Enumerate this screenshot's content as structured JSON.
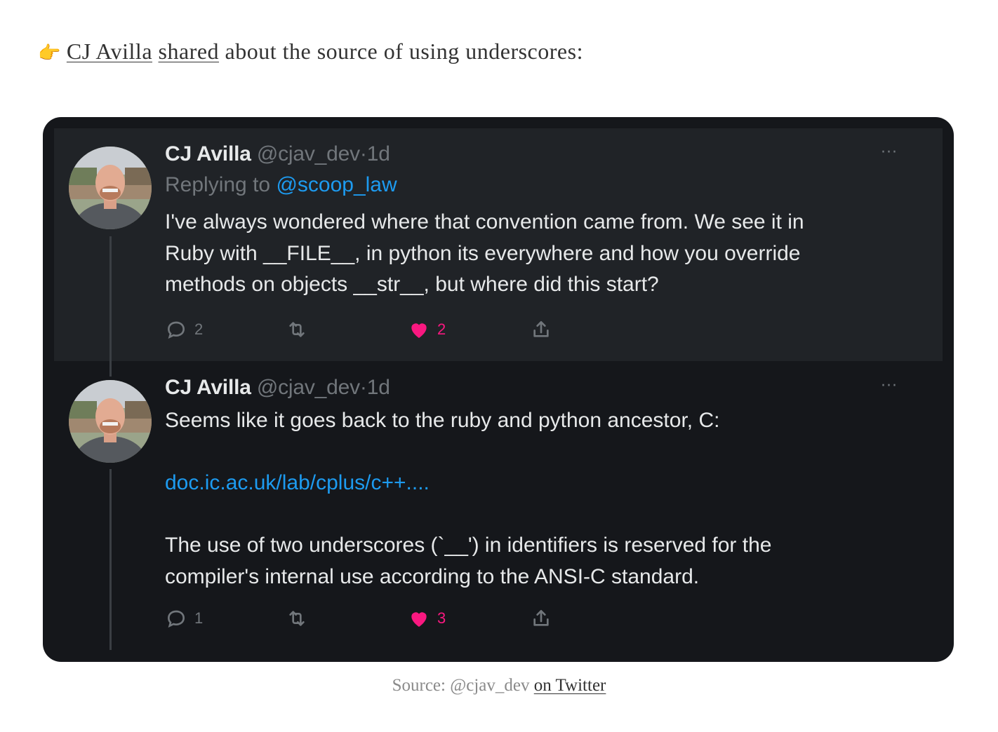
{
  "intro": {
    "emoji": "👉",
    "author_link": "CJ Avilla",
    "shared_link": "shared",
    "rest": " about the source of using underscores:"
  },
  "tweets": [
    {
      "name": "CJ Avilla",
      "handle": "@cjav_dev",
      "sep": "·",
      "time": "1d",
      "replying_prefix": "Replying to ",
      "replying_to": "@scoop_law",
      "lines": [
        "I've always wondered where that convention came from. We see it in",
        "Ruby with __FILE__, in python its everywhere and how you override",
        "methods on objects __str__, but where did this start?"
      ],
      "replies": "2",
      "retweets": "",
      "likes": "2",
      "more": "···"
    },
    {
      "name": "CJ Avilla",
      "handle": "@cjav_dev",
      "sep": "·",
      "time": "1d",
      "line1": "Seems like it goes back to the ruby and python ancestor, C:",
      "link": "doc.ic.ac.uk/lab/cplus/c++....",
      "lines": [
        "The use of two underscores (`__') in identifiers is reserved for the",
        "compiler's internal use according to the ANSI-C standard."
      ],
      "replies": "1",
      "retweets": "",
      "likes": "3",
      "more": "···"
    }
  ],
  "caption": {
    "prefix": "Source: @cjav_dev ",
    "link": "on Twitter"
  },
  "colors": {
    "card_bg": "#15171b",
    "highlight_bg": "#202327",
    "link_blue": "#1d9bf0",
    "like_pink": "#f91880",
    "muted": "#71767b"
  },
  "icons": [
    "reply-icon",
    "retweet-icon",
    "like-icon",
    "share-icon",
    "more-icon"
  ]
}
